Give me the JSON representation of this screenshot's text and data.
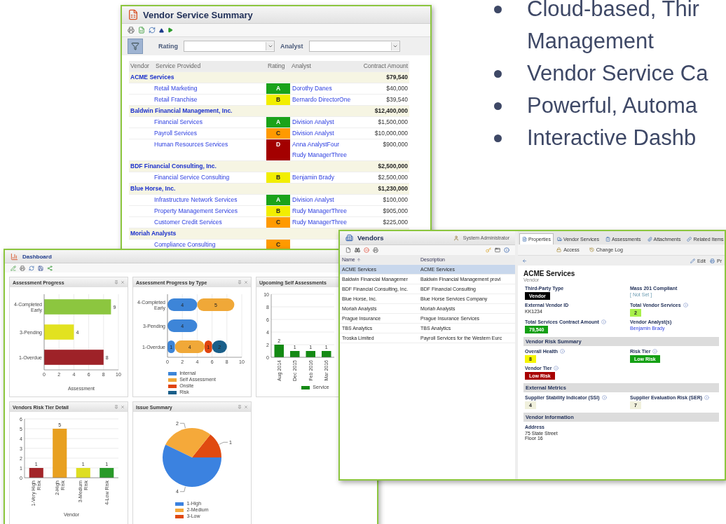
{
  "bullets": [
    {
      "lines": [
        "Cloud-based, Thir",
        "Management"
      ]
    },
    {
      "lines": [
        "Vendor Service Ca"
      ]
    },
    {
      "lines": [
        "Powerful, Automa"
      ]
    },
    {
      "lines": [
        "Interactive Dashb"
      ]
    }
  ],
  "summary": {
    "title": "Vendor Service Summary",
    "filters": [
      {
        "label": "Rating"
      },
      {
        "label": "Analyst"
      }
    ],
    "columns": [
      "Vendor",
      "Service Provided",
      "Rating",
      "Analyst",
      "Contract Amount"
    ],
    "groups": [
      {
        "vendor": "ACME Services",
        "amount": "$79,540",
        "services": [
          {
            "name": "Retail Marketing",
            "rating": "A",
            "color": "#1aa31a",
            "analysts": [
              "Dorothy Danes"
            ],
            "amount": "$40,000"
          },
          {
            "name": "Retail Franchise",
            "rating": "B",
            "color": "#f2ee00",
            "analysts": [
              "Bernardo DirectorOne"
            ],
            "amount": "$39,540"
          }
        ]
      },
      {
        "vendor": "Baldwin Financial Management, Inc.",
        "amount": "$12,400,000",
        "services": [
          {
            "name": "Financial Services",
            "rating": "A",
            "color": "#1aa31a",
            "analysts": [
              "Division Analyst"
            ],
            "amount": "$1,500,000"
          },
          {
            "name": "Payroll Services",
            "rating": "C",
            "color": "#ff9a00",
            "analysts": [
              "Division Analyst"
            ],
            "amount": "$10,000,000"
          },
          {
            "name": "Human Resources Services",
            "rating": "D",
            "color": "#a30000",
            "analysts": [
              "Anna AnalystFour",
              "Rudy ManagerThree"
            ],
            "amount": "$900,000"
          }
        ]
      },
      {
        "vendor": "BDF Financial Consulting, Inc.",
        "amount": "$2,500,000",
        "services": [
          {
            "name": "Financial Service Consulting",
            "rating": "B",
            "color": "#f2ee00",
            "analysts": [
              "Benjamin Brady"
            ],
            "amount": "$2,500,000"
          }
        ]
      },
      {
        "vendor": "Blue Horse, Inc.",
        "amount": "$1,230,000",
        "services": [
          {
            "name": "Infrastructure Network Services",
            "rating": "A",
            "color": "#1aa31a",
            "analysts": [
              "Division Analyst"
            ],
            "amount": "$100,000"
          },
          {
            "name": "Property Management Services",
            "rating": "B",
            "color": "#f2ee00",
            "analysts": [
              "Rudy ManagerThree"
            ],
            "amount": "$905,000"
          },
          {
            "name": "Customer Credit Services",
            "rating": "C",
            "color": "#ff9a00",
            "analysts": [
              "Rudy ManagerThree"
            ],
            "amount": "$225,000"
          }
        ]
      },
      {
        "vendor": "Moriah Analysts",
        "services": [
          {
            "name": "Compliance Consulting",
            "rating": "C",
            "color": "#ff9a00"
          }
        ]
      }
    ]
  },
  "dashboard": {
    "title": "Dashboard",
    "panels": [
      {
        "title": "Assessment Progress",
        "chart_data": {
          "type": "bar",
          "orientation": "horizontal",
          "categories": [
            "4-Completed Early",
            "3-Pending",
            "1-Overdue"
          ],
          "series": [
            {
              "values": [
                9,
                4,
                8
              ]
            }
          ],
          "colors": [
            "#8cc63f",
            "#e2e220",
            "#9e2228"
          ],
          "xlabel": "Assessment",
          "xlim": [
            0,
            10
          ],
          "xticks": [
            0,
            2,
            4,
            6,
            8,
            10
          ],
          "grid": true,
          "data_labels": true
        }
      },
      {
        "title": "Assessment Progress by Type",
        "chart_data": {
          "type": "bar",
          "orientation": "horizontal",
          "stacked": true,
          "categories": [
            "4-Completed Early",
            "3-Pending",
            "1-Overdue"
          ],
          "series": [
            {
              "name": "Internal",
              "color": "#3d85d8",
              "values": [
                4,
                4,
                1
              ]
            },
            {
              "name": "Self Assessment",
              "color": "#f0a838",
              "values": [
                5,
                null,
                4
              ]
            },
            {
              "name": "Onsite",
              "color": "#e0440e",
              "values": [
                null,
                null,
                1
              ]
            },
            {
              "name": "Risk",
              "color": "#1a5f8a",
              "values": [
                null,
                null,
                2
              ]
            }
          ],
          "xlim": [
            0,
            10
          ],
          "xticks": [
            0,
            2,
            4,
            6,
            8,
            10
          ],
          "grid": true,
          "data_labels": true
        }
      },
      {
        "title": "Upcoming Self Assessments",
        "chart_data": {
          "type": "bar",
          "orientation": "vertical",
          "categories": [
            "Aug 2014",
            "Dec 2015",
            "Feb 2016",
            "Mar 2016"
          ],
          "series": [
            {
              "name": "Service",
              "color": "#138a13",
              "values": [
                2,
                1,
                1,
                1
              ]
            }
          ],
          "ylim": [
            0,
            10
          ],
          "yticks": [
            0,
            2,
            4,
            6,
            8,
            10
          ],
          "grid": true,
          "data_labels": true
        }
      },
      {
        "title": "Vendors Risk Tier Detail",
        "chart_data": {
          "type": "bar",
          "orientation": "vertical",
          "categories": [
            "1-Very High Risk",
            "2-High Risk",
            "3-Medium Risk",
            "4-Low Risk"
          ],
          "series": [
            {
              "values": [
                1,
                5,
                1,
                1
              ]
            }
          ],
          "colors": [
            "#a3262a",
            "#e8a020",
            "#dede22",
            "#2a9a2a"
          ],
          "xlabel": "Vendor",
          "ylim": [
            0,
            6
          ],
          "yticks": [
            0,
            1,
            2,
            3,
            4,
            5,
            6
          ],
          "grid": true,
          "data_labels": true
        }
      },
      {
        "title": "Issue Summary",
        "chart_data": {
          "type": "pie",
          "categories": [
            "1-High",
            "2-Medium",
            "3-Low"
          ],
          "values": [
            4,
            2,
            1
          ],
          "colors": [
            "#3b82e0",
            "#f5a93a",
            "#e04a10"
          ],
          "data_labels": true
        }
      }
    ]
  },
  "vendors": {
    "title": "Vendors",
    "user": "System Administrator",
    "columns": [
      "Name",
      "Description"
    ],
    "rows": [
      {
        "name": "ACME Services",
        "description": "ACME Services",
        "selected": true
      },
      {
        "name": "Baldwin Financial Managemer",
        "description": "Baldwin Financial Management provi",
        "selected": false
      },
      {
        "name": "BDF Financial Consulting, Inc.",
        "description": "BDF Financial Consulting",
        "selected": false
      },
      {
        "name": "Blue Horse, Inc.",
        "description": "Blue Horse Services Company",
        "selected": false
      },
      {
        "name": "Moriah Analysts",
        "description": "Moriah Analysts",
        "selected": false
      },
      {
        "name": "Prague Insurance",
        "description": "Prague Insurance Services",
        "selected": false
      },
      {
        "name": "TBS Analytics",
        "description": "TBS Analytics",
        "selected": false
      },
      {
        "name": "Troska Limited",
        "description": "Payroll Services for the Western Eurc",
        "selected": false
      }
    ],
    "tabs": [
      {
        "label": "Properties",
        "selected": true
      },
      {
        "label": "Vendor Services",
        "selected": false
      },
      {
        "label": "Assessments",
        "selected": false
      },
      {
        "label": "Attachments",
        "selected": false
      },
      {
        "label": "Related Items",
        "selected": false
      }
    ],
    "links": [
      "Access",
      "Change Log"
    ],
    "actions": [
      "Edit",
      "Pr"
    ],
    "details": {
      "title": "ACME Services",
      "subtitle": "Vendor",
      "fields": [
        {
          "label": "Third-Party Type",
          "kind": "badge",
          "value": "Vendor",
          "color": "#000000",
          "info": false
        },
        {
          "label": "Mass 201 Compliant",
          "kind": "muted",
          "value": "[ Not Set ]",
          "info": false
        },
        {
          "label": "External Vendor ID",
          "kind": "text",
          "value": "KK1234",
          "info": false
        },
        {
          "label": "Total Vendor Services",
          "kind": "badge",
          "value": "2",
          "color": "#a8f04a",
          "info": true
        },
        {
          "label": "Total Services Contract Amount",
          "kind": "badge",
          "value": "79,540",
          "color": "#14a014",
          "info": true
        },
        {
          "label": "Vendor Analyst(s)",
          "kind": "link",
          "value": "Benjamin Brady",
          "info": false
        }
      ],
      "sections": [
        {
          "heading": "Vendor Risk Summary",
          "fields": [
            {
              "label": "Overall Health",
              "kind": "badge",
              "value": "8",
              "color": "#f5f500",
              "info": true
            },
            {
              "label": "Risk Tier",
              "kind": "badge",
              "value": "Low Risk",
              "color": "#14a014",
              "info": true
            },
            {
              "label": "Vendor Tier",
              "kind": "badge",
              "value": "Low Risk",
              "color": "#a80000",
              "info": true
            }
          ]
        },
        {
          "heading": "External Metrics",
          "fields": [
            {
              "label": "Supplier Stability Indicator (SSI)",
              "kind": "badge",
              "value": "4",
              "color": "#f0f0dc",
              "info": true
            },
            {
              "label": "Supplier Evaluation Risk (SER)",
              "kind": "badge",
              "value": "7",
              "color": "#f0f0dc",
              "info": true
            }
          ]
        },
        {
          "heading": "Vendor Information",
          "fields": [
            {
              "label": "Address",
              "kind": "lines",
              "lines": [
                "75 State Street",
                "Floor 16"
              ],
              "info": false
            }
          ]
        }
      ]
    }
  }
}
